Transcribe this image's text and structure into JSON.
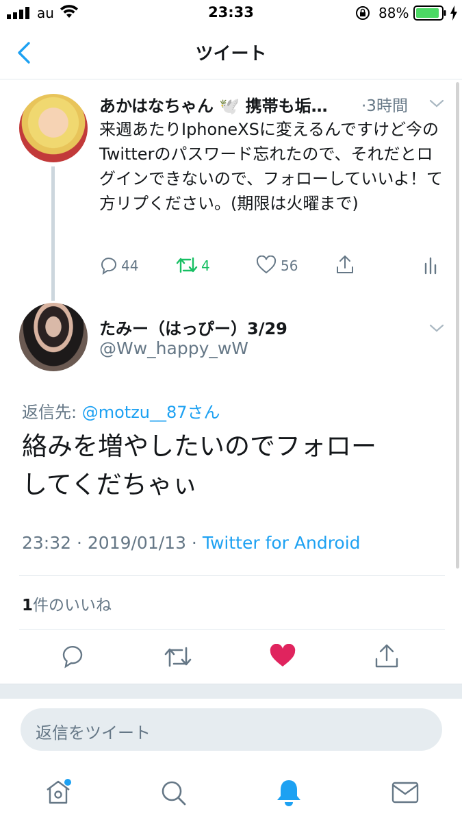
{
  "status_bar": {
    "carrier": "au",
    "time": "23:33",
    "battery_percent": "88%"
  },
  "nav": {
    "title": "ツイート"
  },
  "parent_tweet": {
    "display_name": "あかはなちゃん 🕊️ 携帯も垢…",
    "time_ago": "·3時間",
    "text": "来週あたりIphoneXSに変えるんですけど今のTwitterのパスワード忘れたので、それだとログインできないので、フォローしていいよ！て方リプください。(期限は火曜まで)",
    "reply_count": "44",
    "retweet_count": "4",
    "like_count": "56"
  },
  "main_tweet": {
    "display_name": "たみー（はっぴー）3/29",
    "handle": "@Ww_happy_wW",
    "reply_to_label": "返信先: ",
    "reply_to_user": "@motzu__87さん",
    "text_line1": "絡みを増やしたいのでフォロー",
    "text_line2": "してくだちゃぃ",
    "timestamp": "23:32 · 2019/01/13 · ",
    "source": "Twitter for Android",
    "likes_count": "1",
    "likes_label": "件のいいね"
  },
  "reply_composer": {
    "placeholder": "返信をツイート"
  },
  "colors": {
    "accent": "#1da1f2",
    "retweet_green": "#17bf63",
    "like_red": "#e0245e",
    "battery_green": "#4cd964",
    "secondary_text": "#657786"
  },
  "icons": {
    "back": "chevron-left-icon",
    "reply": "speech-bubble-icon",
    "retweet": "retweet-arrows-icon",
    "like": "heart-icon",
    "share": "share-upload-icon",
    "analytics": "bar-chart-icon",
    "caret": "chevron-down-icon",
    "home": "home-icon",
    "search": "search-icon",
    "notifications": "bell-icon",
    "messages": "envelope-icon"
  }
}
